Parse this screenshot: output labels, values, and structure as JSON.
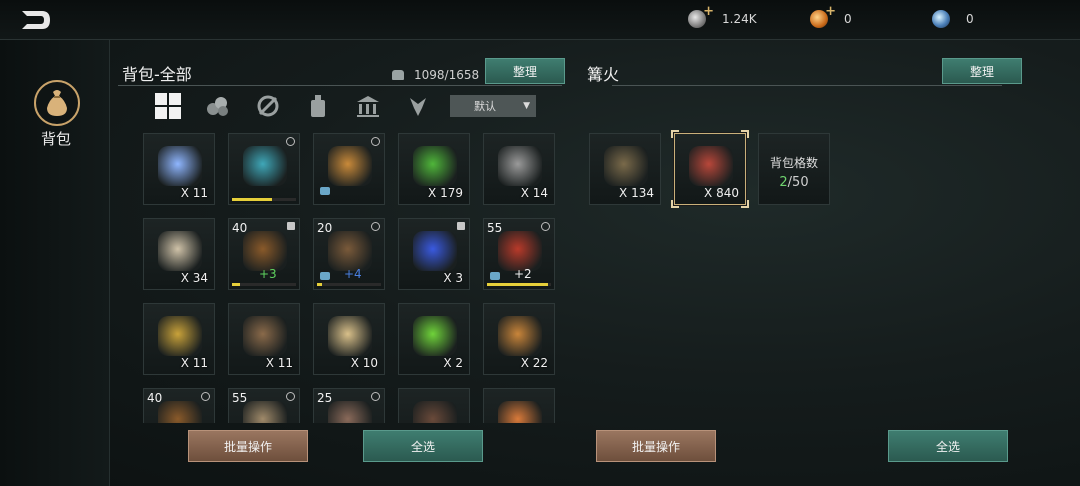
{
  "topbar": {
    "resources": [
      {
        "name": "silver-coin",
        "value": "1.24K",
        "has_plus": true
      },
      {
        "name": "gold-coin",
        "value": "0",
        "has_plus": true
      },
      {
        "name": "gem",
        "value": "0",
        "has_plus": false
      }
    ]
  },
  "sidebar": {
    "bag_label": "背包"
  },
  "left_panel": {
    "title": "背包-全部",
    "capacity": "1098/1658",
    "sort_button": "整理",
    "sort_dropdown": "默认",
    "batch_button": "批量操作",
    "select_all_button": "全选",
    "filters": [
      "all",
      "materials",
      "equipment",
      "consumables",
      "buildings",
      "quest"
    ],
    "items": [
      {
        "art": "spirit-orb",
        "qty": "X 11",
        "color": "#8fb6ff"
      },
      {
        "art": "staff",
        "qty": "",
        "color": "#3fa7b8",
        "bar": 0.62,
        "link": true
      },
      {
        "art": "golden-shield",
        "qty": "",
        "color": "#c98a3a",
        "link": true,
        "shirt": true
      },
      {
        "art": "herb",
        "qty": "X 179",
        "color": "#4fb63a"
      },
      {
        "art": "stone",
        "qty": "X 14",
        "color": "#9a9a9a"
      },
      {
        "art": "fur",
        "qty": "X 34",
        "color": "#cfc2a8"
      },
      {
        "art": "bow",
        "qty": "",
        "lvl": "40",
        "plus": "+3",
        "plus_color": "#5fd35f",
        "color": "#8a5a2a",
        "bar": 0.12,
        "lock": true
      },
      {
        "art": "club",
        "qty": "",
        "lvl": "20",
        "plus": "+4",
        "plus_color": "#4a7fe0",
        "color": "#7a5a3a",
        "bar": 0.08,
        "link": true,
        "shirt": true
      },
      {
        "art": "crystal",
        "qty": "X 3",
        "color": "#3a5ae0",
        "lock": true
      },
      {
        "art": "fire-staff",
        "qty": "",
        "lvl": "55",
        "plus": "+2",
        "plus_color": "#f0f0f0",
        "color": "#b83a2a",
        "bar": 0.95,
        "link": true,
        "shirt": true
      },
      {
        "art": "rope",
        "qty": "X 11",
        "color": "#c9a23a"
      },
      {
        "art": "sack",
        "qty": "X 11",
        "color": "#8a6a4a"
      },
      {
        "art": "bread",
        "qty": "X 10",
        "color": "#d9c08a"
      },
      {
        "art": "horn",
        "qty": "X 2",
        "color": "#6fd33a"
      },
      {
        "art": "leather",
        "qty": "X 22",
        "color": "#c9853a"
      },
      {
        "art": "bow-2",
        "qty": "",
        "lvl": "40",
        "color": "#8a5a2a",
        "link": true
      },
      {
        "art": "crossbow",
        "qty": "",
        "lvl": "55",
        "color": "#a08a6a",
        "link": true
      },
      {
        "art": "trident",
        "qty": "",
        "lvl": "25",
        "color": "#8a6a5a",
        "link": true
      },
      {
        "art": "antler",
        "qty": "",
        "color": "#6a4a3a"
      },
      {
        "art": "scroll",
        "qty": "",
        "color": "#d97a3a"
      }
    ]
  },
  "right_panel": {
    "title": "篝火",
    "sort_button": "整理",
    "batch_button": "批量操作",
    "select_all_button": "全选",
    "items": [
      {
        "art": "wood-plank",
        "qty": "X 134",
        "color": "#7a6a4a"
      },
      {
        "art": "raw-meat",
        "qty": "X 840",
        "color": "#b8473a",
        "selected": true
      }
    ],
    "capacity_label": "背包格数",
    "capacity_used": "2",
    "capacity_total": "/50"
  }
}
